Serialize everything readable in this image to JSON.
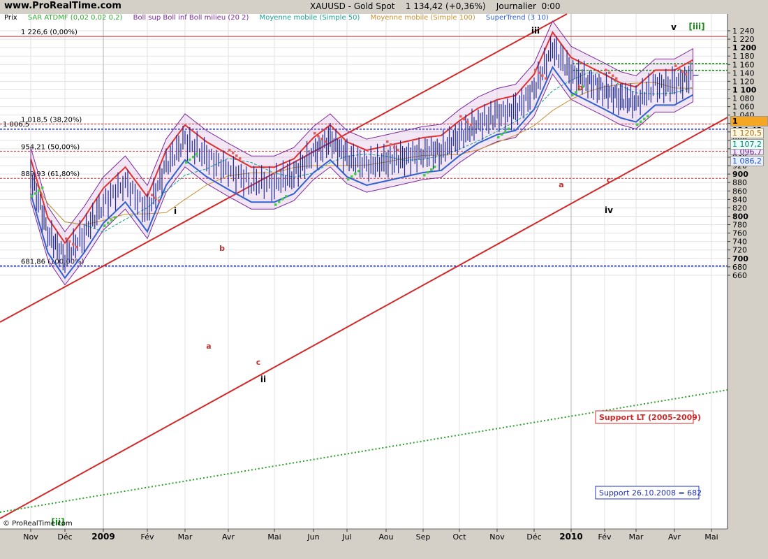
{
  "header": {
    "site": "www.ProRealTime.com",
    "title": "XAUUSD - Gold Spot    1 134,42 (+0,36%)    Journalier  0:00"
  },
  "legend": {
    "prix": "Prix",
    "items": [
      {
        "label": "SAR ATDMF (0,02 0,02 0,2)",
        "color": "#33aa33"
      },
      {
        "label": "Boll sup Boll inf Boll milieu (20 2)",
        "color": "#7b2a9b"
      },
      {
        "label": "Moyenne mobile (Simple 50)",
        "color": "#18a090"
      },
      {
        "label": "Moyenne mobile (Simple 100)",
        "color": "#c89030"
      },
      {
        "label": "SuperTrend (3 10)",
        "color": "#3060d0"
      }
    ]
  },
  "price_badges": {
    "last": "1 134,42",
    "sma100": "1 120,5",
    "sma50": "1 107,2",
    "boll_low": "1 096,7",
    "supertrend": "1 086,2"
  },
  "copyright": "© ProRealTime.com",
  "chart_data": {
    "type": "line",
    "instrument": "XAUUSD - Gold Spot",
    "timeframe": "Journalier",
    "ylim": [
      655,
      1250
    ],
    "y_ticks": [
      660,
      680,
      700,
      720,
      740,
      760,
      780,
      800,
      820,
      840,
      860,
      880,
      900,
      920,
      940,
      960,
      980,
      1000,
      1020,
      1040,
      1060,
      1080,
      1100,
      1120,
      1140,
      1160,
      1180,
      1200,
      1220,
      1240
    ],
    "y_tick_labels": [
      "660",
      "680",
      "700",
      "720",
      "740",
      "760",
      "780",
      "800",
      "820",
      "840",
      "860",
      "880",
      "900",
      "920",
      "940",
      "960",
      "980",
      "1 000",
      "1 020",
      "1 040",
      "1 060",
      "1 080",
      "1 100",
      "1 120",
      "1 140",
      "1 160",
      "1 180",
      "1 200",
      "1 220",
      "1 240"
    ],
    "x_labels": [
      "Nov",
      "Déc",
      "2009",
      "Fév",
      "Mar",
      "Avr",
      "Mai",
      "Jun",
      "Jul",
      "Aou",
      "Sep",
      "Oct",
      "Nov",
      "Déc",
      "2010",
      "Fév",
      "Mar",
      "Avr",
      "Mai"
    ],
    "series": [
      {
        "x": [
          "Oct",
          "Nov",
          "Nov",
          "Déc",
          "Déc",
          "2009",
          "2009",
          "Fév",
          "Fév",
          "Mar",
          "Mar",
          "Avr",
          "Avr",
          "Mai",
          "Mai",
          "Jun",
          "Jun",
          "Jul",
          "Jul",
          "Aou",
          "Aou",
          "Sep",
          "Sep",
          "Oct",
          "Oct",
          "Nov",
          "Nov",
          "Déc",
          "Déc",
          "2010",
          "2010",
          "Fév",
          "Fév",
          "Mar",
          "Mar",
          "Avr"
        ],
        "values": [
          900,
          760,
          700,
          760,
          830,
          880,
          810,
          920,
          980,
          940,
          910,
          880,
          880,
          900,
          950,
          980,
          940,
          920,
          930,
          940,
          950,
          955,
          990,
          1020,
          1040,
          1050,
          1100,
          1200,
          1140,
          1120,
          1100,
          1080,
          1070,
          1110,
          1110,
          1134.42
        ]
      }
    ],
    "fib_levels": [
      {
        "value": 1226.6,
        "label": "1 226,6 (0,00%)"
      },
      {
        "value": 1018.5,
        "label": "1 018,5 (38,20%)"
      },
      {
        "value": 954.21,
        "label": "954,21 (50,00%)"
      },
      {
        "value": 889.93,
        "label": "889,93 (61,80%)"
      },
      {
        "value": 681.86,
        "label": "681,86 (100,00%)"
      }
    ],
    "hlines": [
      {
        "value": 1006.5,
        "label": "1 006,5"
      },
      {
        "value": 682,
        "label": ""
      },
      {
        "value": 1162,
        "label": ""
      },
      {
        "value": 1146,
        "label": ""
      }
    ],
    "wave_labels": [
      {
        "text": "i",
        "x": "Mar",
        "y": 1019
      },
      {
        "text": "ii",
        "x": "Avr",
        "y": 870
      },
      {
        "text": "iii",
        "x": "Déc",
        "y": 1227
      },
      {
        "text": "iv",
        "x": "Fév",
        "y": 1060
      },
      {
        "text": "v",
        "x": "Avr",
        "y": 1242
      },
      {
        "text": "[iii]",
        "x": "Avr",
        "y": 1242
      },
      {
        "text": "[ii]",
        "x": "Nov",
        "y": 681
      },
      {
        "text": "a",
        "x": "Mar",
        "y": 875
      },
      {
        "text": "b",
        "x": "Mar",
        "y": 990
      },
      {
        "text": "c",
        "x": "Avr",
        "y": 862
      },
      {
        "text": "a",
        "x": "Déc",
        "y": 1068
      },
      {
        "text": "b",
        "x": "Déc",
        "y": 1168
      },
      {
        "text": "c",
        "x": "Fév",
        "y": 1074
      }
    ],
    "annotations": [
      "Support LT (2005-2009)",
      "Support 26.10.2008 = 682"
    ]
  }
}
